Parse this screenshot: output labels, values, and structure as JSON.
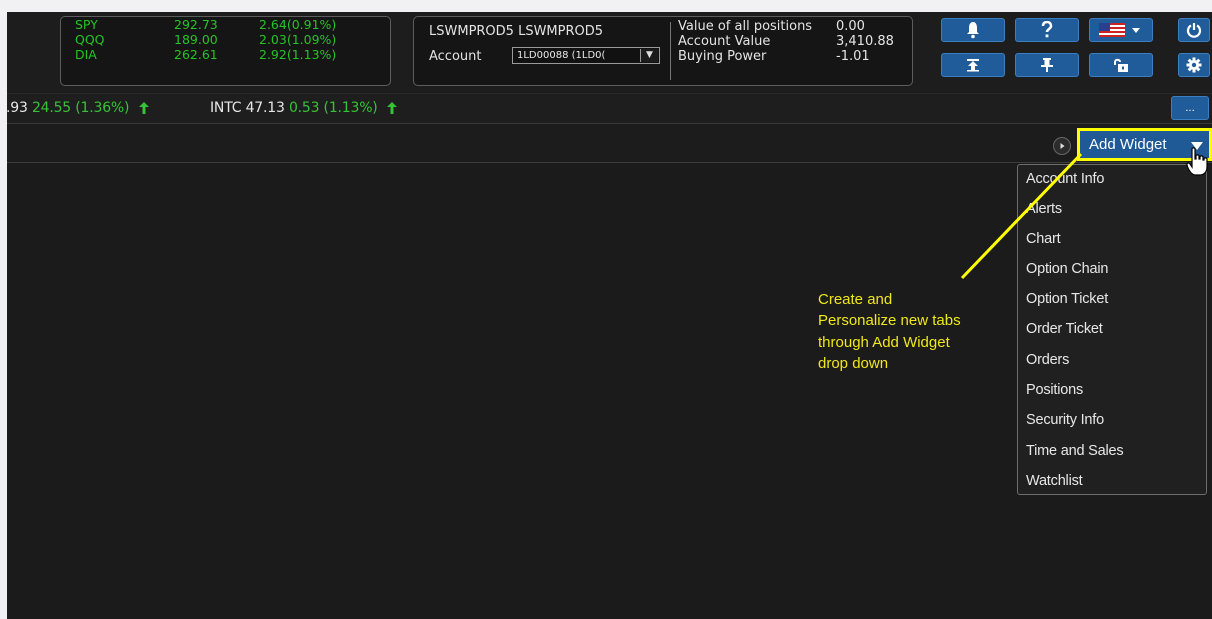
{
  "quotes": [
    {
      "symbol": "SPY",
      "price": "292.73",
      "change": "2.64(0.91%)"
    },
    {
      "symbol": "QQQ",
      "price": "189.00",
      "change": "2.03(1.09%)"
    },
    {
      "symbol": "DIA",
      "price": "262.61",
      "change": "2.92(1.13%)"
    }
  ],
  "account": {
    "name": "LSWMPROD5 LSWMPROD5",
    "account_label": "Account",
    "account_value_selected": "1LD00088 (1LD0(",
    "summary_labels": [
      "Value of all positions",
      "Account Value",
      "Buying Power"
    ],
    "summary_values": [
      "0.00",
      "3,410.88",
      "-1.01"
    ]
  },
  "ticker": [
    {
      "symbol": "",
      "price": ".93",
      "change": "24.55 (1.36%)"
    },
    {
      "symbol": "INTC",
      "price": "47.13",
      "change": "0.53 (1.13%)"
    }
  ],
  "ticker_more_label": "...",
  "add_widget_label": "Add Widget",
  "widget_menu": [
    "Account Info",
    "Alerts",
    "Chart",
    "Option Chain",
    "Option Ticket",
    "Order Ticket",
    "Orders",
    "Positions",
    "Security Info",
    "Time and Sales",
    "Watchlist"
  ],
  "annotation_lines": [
    "Create and",
    "Personalize new tabs",
    "through Add Widget",
    "drop down"
  ],
  "colors": {
    "positive": "#26c326",
    "button_blue": "#215c9a",
    "highlight_yellow": "#ffff00",
    "annotation_yellow": "#f0e81a"
  },
  "icons": [
    "bell-icon",
    "help-icon",
    "us-flag-icon",
    "power-icon",
    "upload-icon",
    "pin-icon",
    "unlock-icon",
    "gear-icon",
    "up-arrow-icon",
    "hand-cursor-icon"
  ]
}
